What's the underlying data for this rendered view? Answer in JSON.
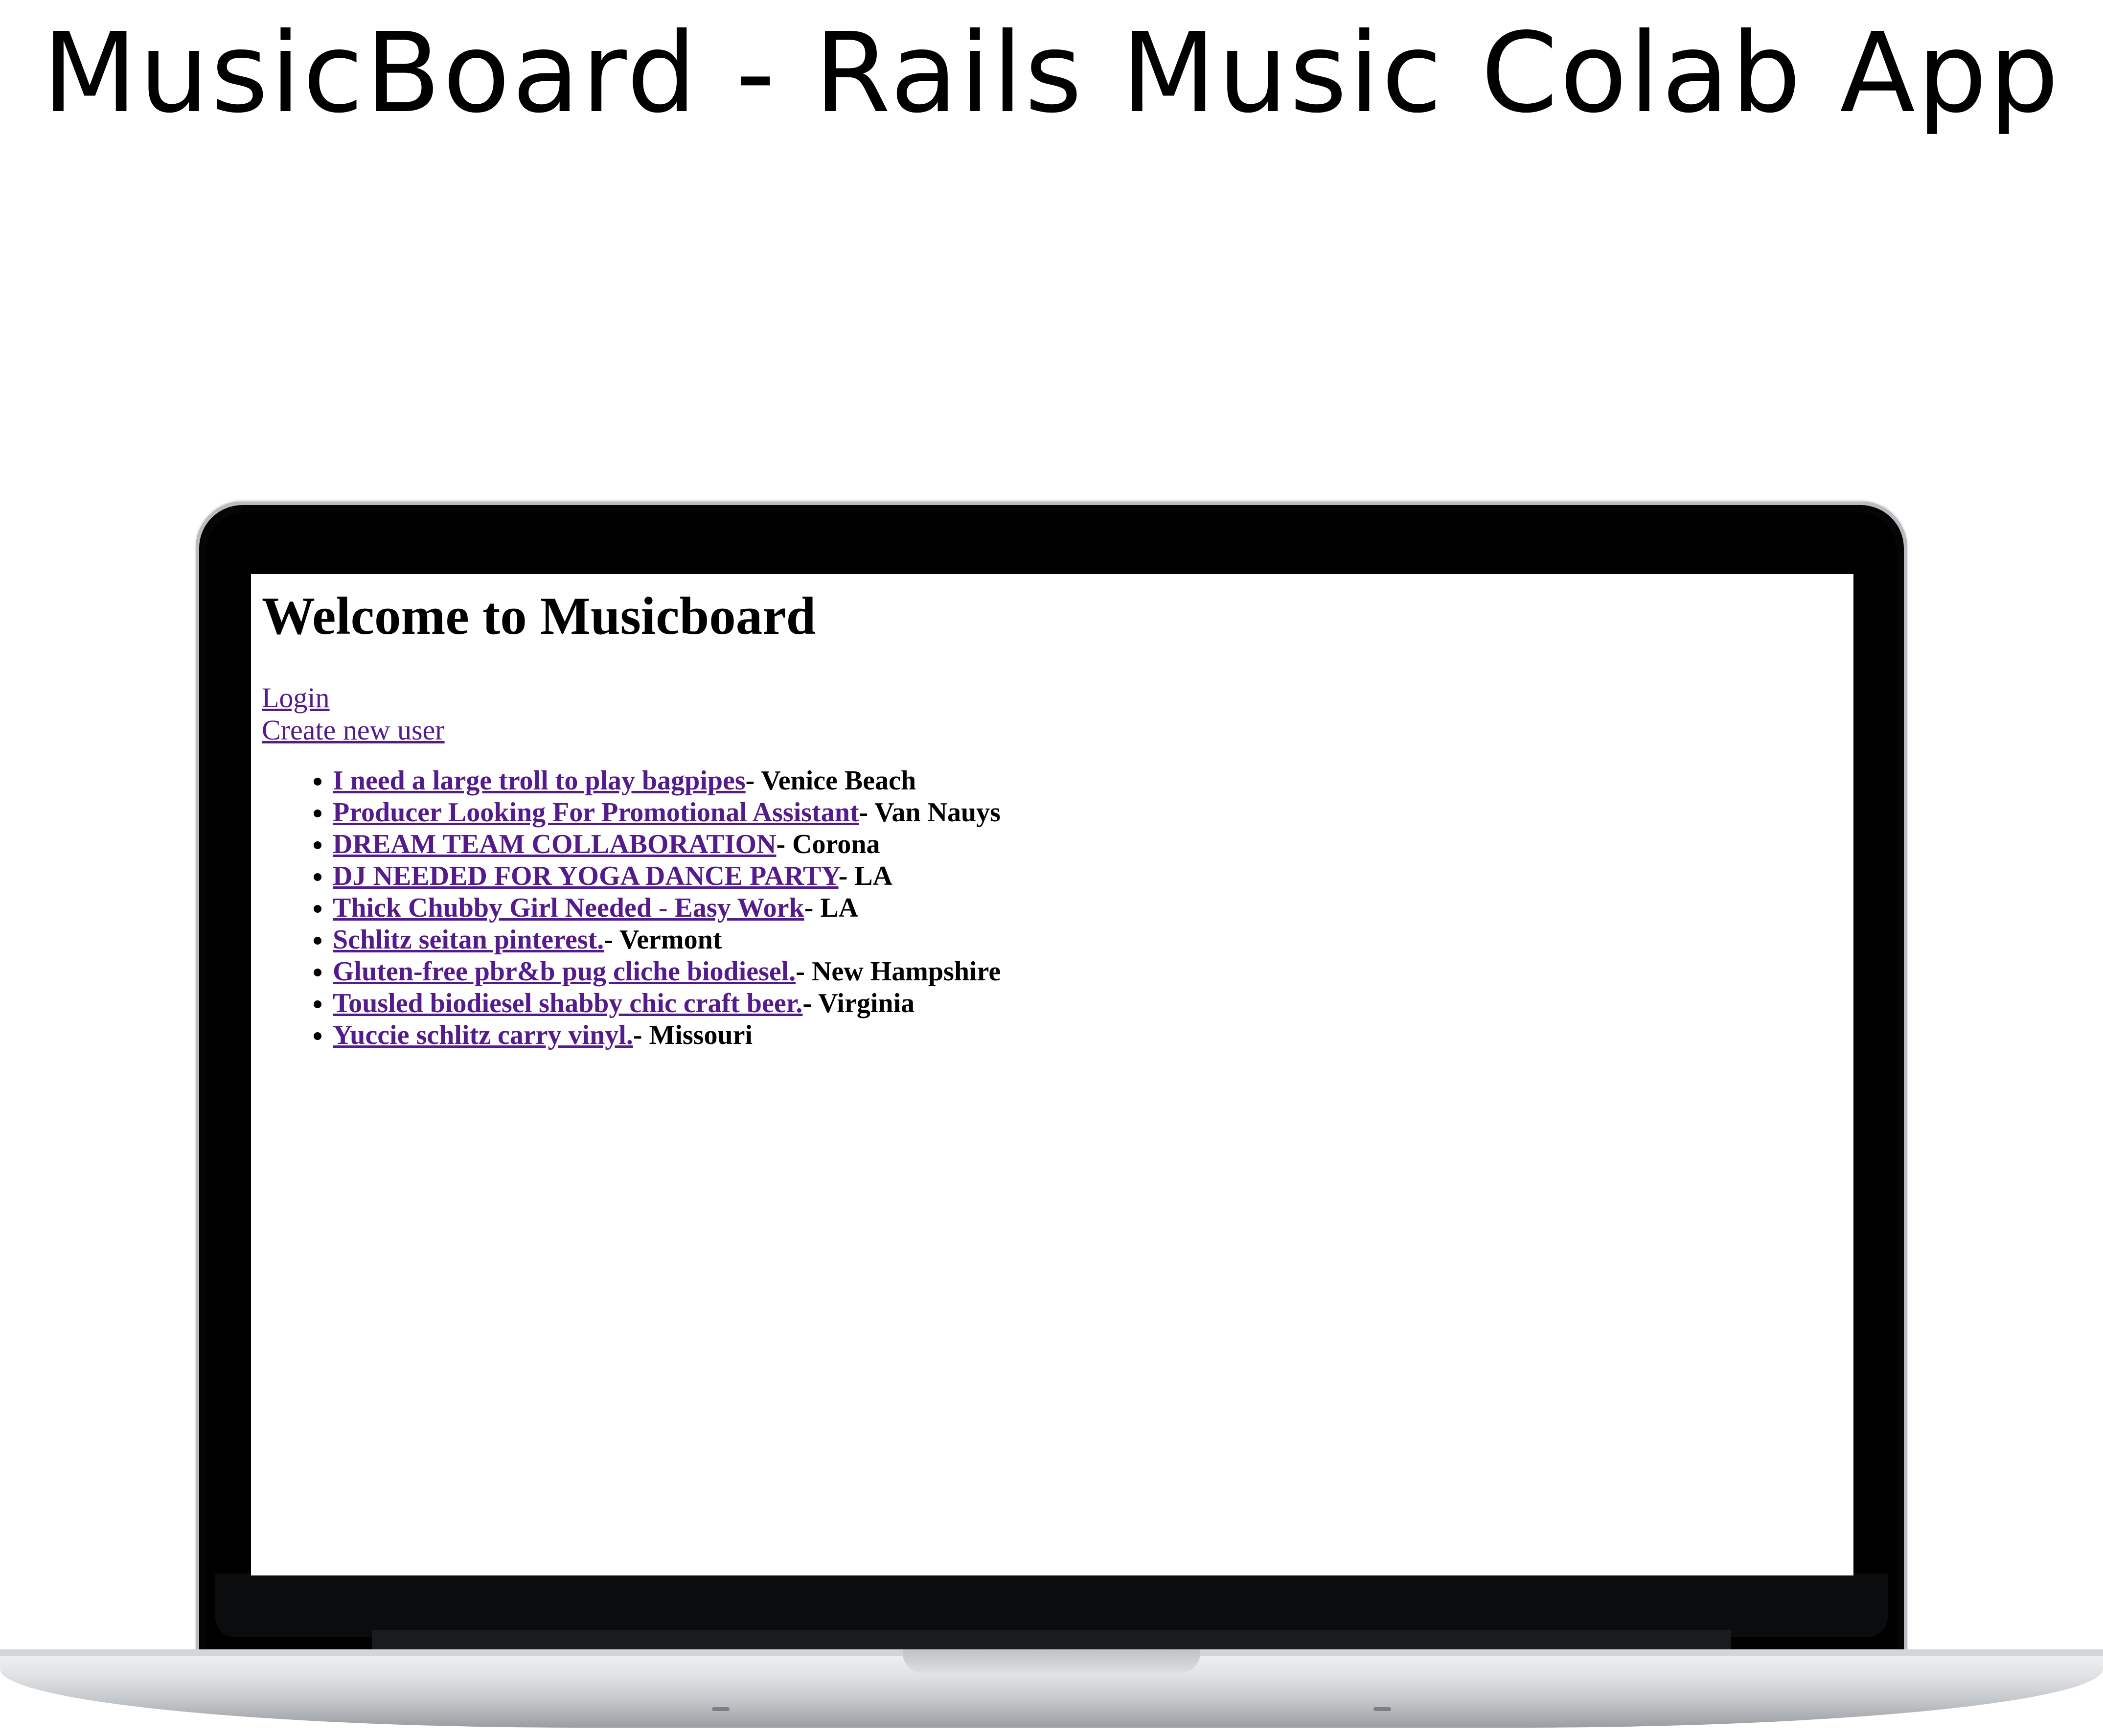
{
  "title": "MusicBoard - Rails Music Colab App",
  "screen": {
    "heading": "Welcome to Musicboard",
    "links": {
      "login": "Login",
      "create_user": "Create new user"
    },
    "postings": [
      {
        "title": "I need a large troll to play bagpipes",
        "location": "- Venice Beach"
      },
      {
        "title": "Producer Looking For Promotional Assistant",
        "location": "- Van Nauys"
      },
      {
        "title": "DREAM TEAM COLLABORATION",
        "location": "- Corona"
      },
      {
        "title": "DJ NEEDED FOR YOGA DANCE PARTY",
        "location": "- LA"
      },
      {
        "title": "Thick Chubby Girl Needed - Easy Work",
        "location": "- LA"
      },
      {
        "title": "Schlitz seitan pinterest.",
        "location": "- Vermont"
      },
      {
        "title": "Gluten-free pbr&b pug cliche biodiesel.",
        "location": "- New Hampshire"
      },
      {
        "title": "Tousled biodiesel shabby chic craft beer.",
        "location": "- Virginia"
      },
      {
        "title": "Yuccie schlitz carry vinyl.",
        "location": "- Missouri"
      }
    ]
  },
  "colors": {
    "visited_link": "#551a8b",
    "bezel": "#000000",
    "aluminum": "#d3d5d8"
  }
}
